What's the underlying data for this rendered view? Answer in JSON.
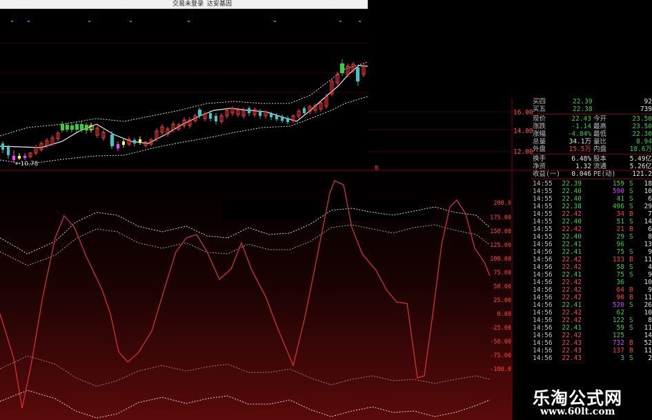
{
  "titlebar": {
    "text1": "交易未登录",
    "text2": "达安基因"
  },
  "kline": {
    "price_labels": [
      "16.00",
      "14.00",
      "12.00"
    ],
    "low_label": "10.78",
    "marker": "B"
  },
  "indicator": {
    "axis_labels": [
      "200.0",
      "175.00",
      "150.00",
      "125.00",
      "100.00",
      "75.00",
      "50.00",
      "25.00",
      "0.00",
      "-25.00",
      "-50.00",
      "-75.00",
      "-100.0"
    ]
  },
  "quote": {
    "book": [
      {
        "label": "买四",
        "price": "22.39",
        "vol": "92"
      },
      {
        "label": "买五",
        "price": "22.38",
        "vol": "739"
      }
    ],
    "stats": [
      {
        "l1": "现价",
        "v1": "22.43",
        "l2": "今开",
        "v2": "23.50"
      },
      {
        "l1": "涨跌",
        "v1": "-1.14",
        "l2": "最高",
        "v2": "23.50"
      },
      {
        "l1": "涨幅",
        "v1": "-4.84%",
        "l2": "最低",
        "v2": "22.30"
      },
      {
        "l1": "总量",
        "v1": "34.1万",
        "l2": "量比",
        "v2": "8.94"
      },
      {
        "l1": "外盘",
        "v1": "15.5万",
        "l2": "内盘",
        "v2": "18.6万"
      },
      {
        "l1": "换手",
        "v1": "6.48%",
        "l2": "股本",
        "v2": "5.49亿"
      },
      {
        "l1": "净资",
        "v1": "1.32",
        "l2": "流通",
        "v2": "5.26亿"
      },
      {
        "l1": "收益(一)",
        "v1": "0.046",
        "l2": "PE(动)",
        "v2": "121.2"
      }
    ],
    "ticks": [
      {
        "time": "14:55",
        "price": "22.39",
        "vol": "159",
        "side": "S",
        "n": "18"
      },
      {
        "time": "14:55",
        "price": "22.40",
        "vol": "590",
        "side": "S",
        "n": "10"
      },
      {
        "time": "14:55",
        "price": "22.40",
        "vol": "41",
        "side": "S",
        "n": "6"
      },
      {
        "time": "14:55",
        "price": "22.38",
        "vol": "496",
        "side": "S",
        "n": "29"
      },
      {
        "time": "14:55",
        "price": "22.42",
        "vol": "34",
        "side": "B",
        "n": "7"
      },
      {
        "time": "14:55",
        "price": "22.40",
        "vol": "51",
        "side": "S",
        "n": "14"
      },
      {
        "time": "14:55",
        "price": "22.42",
        "vol": "21",
        "side": "B",
        "n": "6"
      },
      {
        "time": "14:55",
        "price": "22.40",
        "vol": "29",
        "side": "S",
        "n": "8"
      },
      {
        "time": "14:56",
        "price": "22.41",
        "vol": "96",
        "side": "",
        "n": "13"
      },
      {
        "time": "14:56",
        "price": "22.41",
        "vol": "75",
        "side": "S",
        "n": "9"
      },
      {
        "time": "14:56",
        "price": "22.42",
        "vol": "133",
        "side": "B",
        "n": "11"
      },
      {
        "time": "14:56",
        "price": "22.42",
        "vol": "58",
        "side": "S",
        "n": "4"
      },
      {
        "time": "14:56",
        "price": "22.41",
        "vol": "75",
        "side": "S",
        "n": "9"
      },
      {
        "time": "14:56",
        "price": "22.42",
        "vol": "36",
        "side": "",
        "n": "10"
      },
      {
        "time": "14:56",
        "price": "22.42",
        "vol": "64",
        "side": "B",
        "n": "9"
      },
      {
        "time": "14:56",
        "price": "22.42",
        "vol": "90",
        "side": "B",
        "n": "11"
      },
      {
        "time": "14:56",
        "price": "22.41",
        "vol": "520",
        "side": "S",
        "n": "26"
      },
      {
        "time": "14:56",
        "price": "22.42",
        "vol": "62",
        "side": "",
        "n": "10"
      },
      {
        "time": "14:56",
        "price": "22.42",
        "vol": "122",
        "side": "S",
        "n": "8"
      },
      {
        "time": "14:56",
        "price": "22.41",
        "vol": "59",
        "side": "S",
        "n": "11"
      },
      {
        "time": "14:56",
        "price": "22.42",
        "vol": "125",
        "side": "",
        "n": "14"
      },
      {
        "time": "14:56",
        "price": "22.43",
        "vol": "732",
        "side": "B",
        "n": "52"
      },
      {
        "time": "14:56",
        "price": "22.43",
        "vol": "137",
        "side": "B",
        "n": "11"
      },
      {
        "time": "14:56",
        "price": "22.43",
        "vol": "3",
        "side": "S",
        "n": "2"
      }
    ]
  },
  "watermark": {
    "cn": "乐淘公式网",
    "url": "www.60lt.com"
  },
  "colors": {
    "up": "#ff4040",
    "down": "#35d135",
    "neutral": "#e6e6e6",
    "large": "#d040ff",
    "panel": "#000000"
  }
}
